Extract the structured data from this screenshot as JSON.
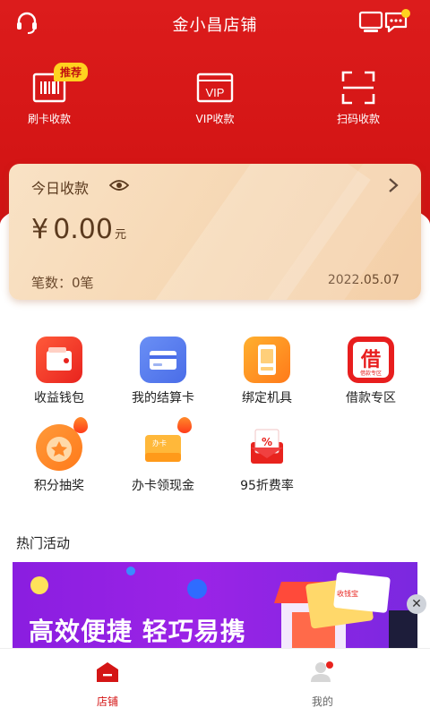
{
  "header": {
    "title": "金小昌店铺"
  },
  "quick_actions": [
    {
      "label": "刷卡收款",
      "badge": "推荐"
    },
    {
      "label": "VIP收款",
      "icon_text": "VIP"
    },
    {
      "label": "扫码收款"
    }
  ],
  "income_card": {
    "title": "今日收款",
    "currency_symbol": "¥",
    "amount": "0.00",
    "unit": "元",
    "count_text": "笔数：0笔",
    "date": "2022.05.07"
  },
  "grid": [
    {
      "label": "收益钱包"
    },
    {
      "label": "我的结算卡"
    },
    {
      "label": "绑定机具"
    },
    {
      "label": "借款专区",
      "icon_char": "借",
      "icon_sub": "借款专区"
    },
    {
      "label": "积分抽奖"
    },
    {
      "label": "办卡领现金",
      "icon_sub": "办卡"
    },
    {
      "label": "95折费率",
      "icon_char": "%"
    }
  ],
  "section": {
    "title": "热门活动"
  },
  "banner": {
    "text": "高效便捷 轻巧易携",
    "logo_text": "收钱宝"
  },
  "bottom_nav": [
    {
      "label": "店铺",
      "active": true
    },
    {
      "label": "我的",
      "active": false
    }
  ],
  "colors": {
    "brand_red": "#d41515",
    "badge_yellow": "#ffd21f",
    "banner_purple": "#9b23e6",
    "nav_active": "#d41515",
    "nav_inactive": "#666666"
  }
}
